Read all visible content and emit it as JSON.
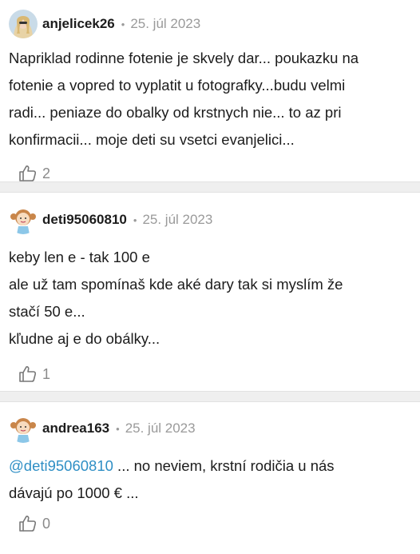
{
  "comments": [
    {
      "username": "anjelicek26",
      "date": "25. júl 2023",
      "avatar_icon": "user-photo-avatar",
      "lines": [
        "Napriklad rodinne fotenie je skvely dar... poukazku na",
        "fotenie a vopred to vyplatit u fotografky...budu velmi",
        "radi... peniaze do obalky od krstnych nie... to az pri",
        "konfirmacii... moje deti su vsetci evanjelici..."
      ],
      "likes": "2"
    },
    {
      "username": "deti95060810",
      "date": "25. júl 2023",
      "avatar_icon": "girl-cartoon-avatar",
      "lines": [
        "keby len e - tak 100 e",
        "ale už tam spomínaš kde aké dary tak si myslím že",
        "stačí 50 e...",
        "kľudne aj e do obálky..."
      ],
      "likes": "1"
    },
    {
      "username": "andrea163",
      "date": "25. júl 2023",
      "avatar_icon": "girl-cartoon-avatar",
      "mention": "@deti95060810",
      "line1_rest": " ... no neviem, krstní rodičia u nás",
      "line2": "dávajú po 1000 € ...",
      "likes": "0"
    }
  ],
  "separator": "•",
  "colors": {
    "mention": "#2f8fc5",
    "meta": "#9a9a9a",
    "divider": "#efefef"
  }
}
